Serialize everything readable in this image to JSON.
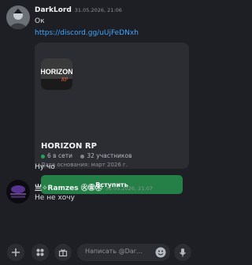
{
  "messages": [
    {
      "author": "DarkLord",
      "timestamp": "31.05.2026, 21:06",
      "lines": [
        "Ок",
        "https://discord.gg/uUjFeDNxh"
      ]
    }
  ],
  "invite": {
    "server_name": "HORIZON RP",
    "online": "6 в сети",
    "members": "32 участников",
    "founded": "Дата основания: март 2026 г.",
    "join_label": "Вступить",
    "icon_word": "HORIZON",
    "icon_sub": "RP",
    "online_color": "#23a55a",
    "members_color": "#80848e"
  },
  "followup": "Ну чо",
  "message2": {
    "author": "亗✧Ramzes ㊋㊎㊍",
    "timestamp": "31.05.2026, 21:07",
    "text": "Не не хочу"
  },
  "composer": {
    "placeholder": "Написать @Dar…",
    "icons": [
      "plus-icon",
      "apps-icon",
      "gift-icon",
      "emoji-icon",
      "microphone-icon"
    ]
  },
  "colors": {
    "background": "#1e1f24",
    "link": "#3ea6ff",
    "join_button": "#248046"
  }
}
